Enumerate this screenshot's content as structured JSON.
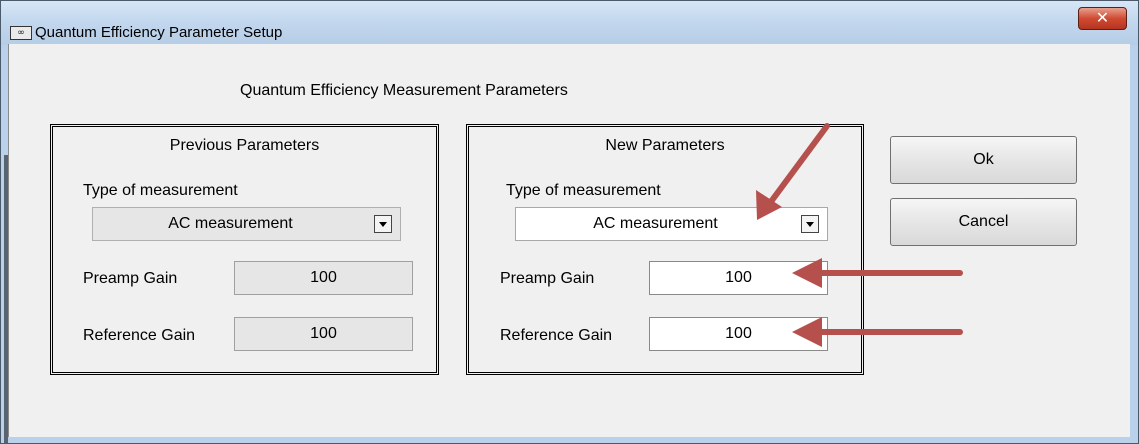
{
  "window": {
    "title": "Quantum Efficiency Parameter Setup",
    "app_icon_glyph": "∞",
    "close_glyph": "✕"
  },
  "main": {
    "heading": "Quantum Efficiency Measurement Parameters"
  },
  "previous": {
    "title": "Previous  Parameters",
    "type_label": "Type of measurement",
    "type_value": "AC measurement",
    "preamp_label": "Preamp Gain",
    "preamp_value": "100",
    "reference_label": "Reference Gain",
    "reference_value": "100"
  },
  "new": {
    "title": "New  Parameters",
    "type_label": "Type of measurement",
    "type_value": "AC measurement",
    "preamp_label": "Preamp Gain",
    "preamp_value": "100",
    "reference_label": "Reference Gain",
    "reference_value": "100"
  },
  "buttons": {
    "ok": "Ok",
    "cancel": "Cancel"
  },
  "annotation_color": "#b5504c"
}
